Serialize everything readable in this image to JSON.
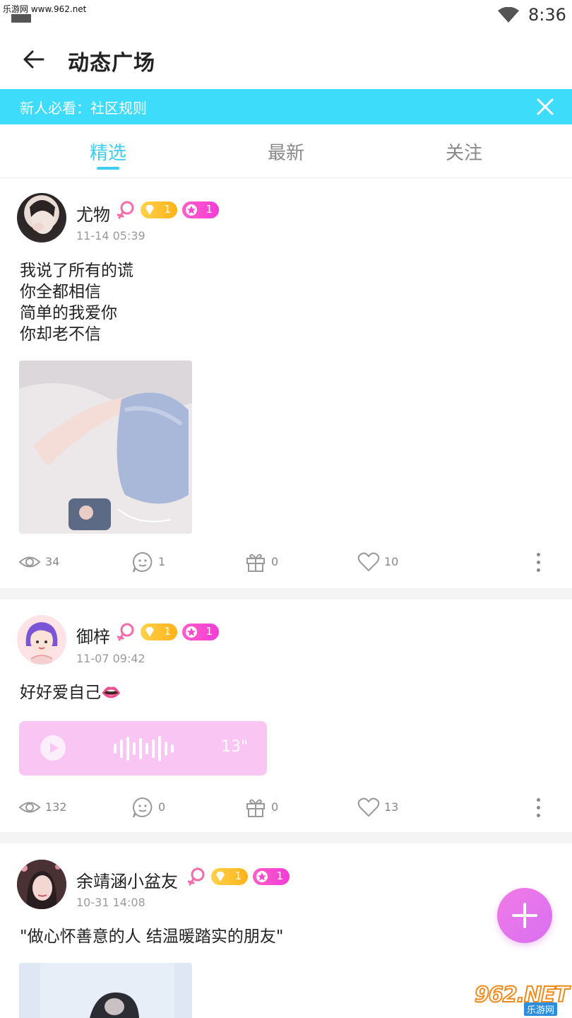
{
  "status_bar": {
    "watermark": "乐游网 www.962.net",
    "time": "8:36"
  },
  "header": {
    "title": "动态广场"
  },
  "banner": {
    "text": "新人必看：社区规则"
  },
  "tabs": [
    {
      "label": "精选",
      "active": true
    },
    {
      "label": "最新",
      "active": false
    },
    {
      "label": "关注",
      "active": false
    }
  ],
  "posts": [
    {
      "username": "尤物",
      "badge_gold": "1",
      "badge_pink": "1",
      "time": "11-14 05:39",
      "lines": [
        "我说了所有的谎",
        "你全都相信",
        "简单的我爱你",
        "你却老不信"
      ],
      "views": "34",
      "comments": "1",
      "gifts": "0",
      "likes": "10"
    },
    {
      "username": "御梓",
      "badge_gold": "1",
      "badge_pink": "1",
      "time": "11-07 09:42",
      "lines": [
        "好好爱自己👄"
      ],
      "voice_duration": "13\"",
      "views": "132",
      "comments": "0",
      "gifts": "0",
      "likes": "13"
    },
    {
      "username": "余靖涵小盆友",
      "badge_gold": "1",
      "badge_pink": "1",
      "time": "10-31 14:08",
      "lines": [
        "\"做心怀善意的人 结温暖踏实的朋友\""
      ]
    }
  ],
  "watermark": {
    "big": "962.NET",
    "small": "乐游网"
  },
  "colors": {
    "accent": "#3ccdf0",
    "banner": "#3ddcfb",
    "fab": "#e477ec",
    "voice": "#f9c6f4"
  }
}
